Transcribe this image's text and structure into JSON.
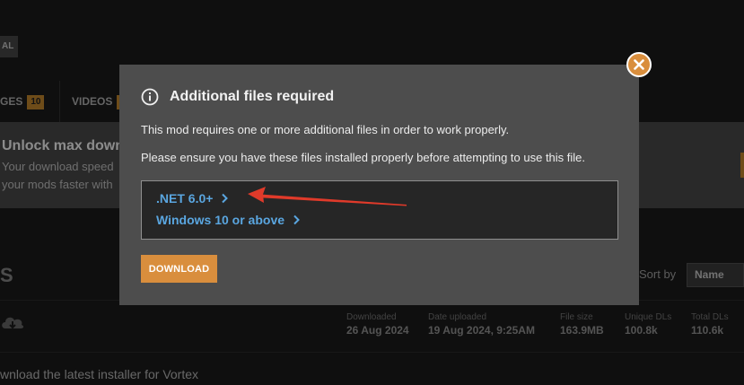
{
  "background": {
    "badge_label": "AL",
    "tabs": [
      {
        "label": "GES",
        "count": "10"
      },
      {
        "label": "VIDEOS",
        "count": "1"
      }
    ],
    "banner": {
      "title": "Unlock max downl",
      "line1": "Your download speed",
      "line2": "your mods faster with"
    },
    "section_letter": "S",
    "sort_label": "Sort by",
    "sort_value": "Name",
    "file_stats": [
      {
        "label": "Downloaded",
        "value": "26 Aug 2024"
      },
      {
        "label": "Date uploaded",
        "value": "19 Aug 2024, 9:25AM"
      },
      {
        "label": "File size",
        "value": "163.9MB"
      },
      {
        "label": "Unique DLs",
        "value": "100.8k"
      },
      {
        "label": "Total DLs",
        "value": "110.6k"
      }
    ],
    "vortex_text": "wnload the latest installer for Vortex"
  },
  "modal": {
    "title": "Additional files required",
    "message1": "This mod requires one or more additional files in order to work properly.",
    "message2": "Please ensure you have these files installed properly before attempting to use this file.",
    "requirements": [
      {
        "label": ".NET 6.0+"
      },
      {
        "label": "Windows 10 or above"
      }
    ],
    "download_label": "DOWNLOAD",
    "icons": {
      "info": "info-icon",
      "close": "close-icon",
      "chevron": "chevron-right-icon"
    }
  },
  "colors": {
    "accent": "#d98e3d",
    "link": "#5aa6e0",
    "annotation_arrow": "#e03a2a"
  }
}
